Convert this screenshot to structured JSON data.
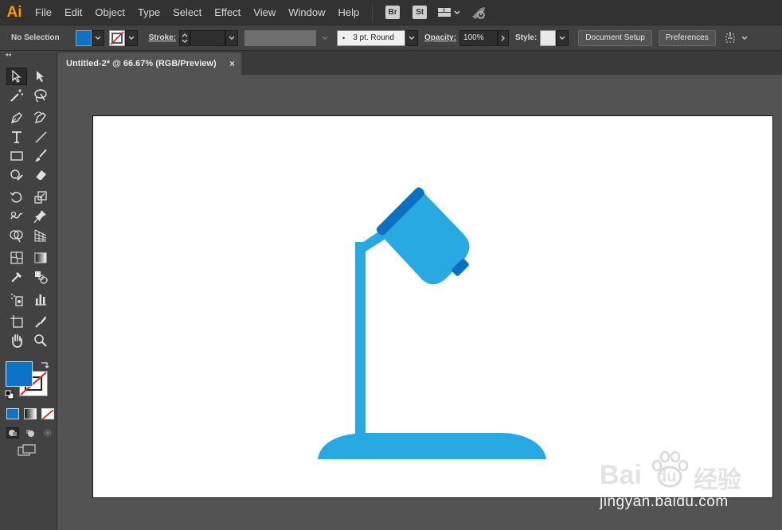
{
  "app": {
    "logo": "Ai"
  },
  "menu": [
    "File",
    "Edit",
    "Object",
    "Type",
    "Select",
    "Effect",
    "View",
    "Window",
    "Help"
  ],
  "menu_badges": {
    "bridge": "Br",
    "stock": "St"
  },
  "control": {
    "selection": "No Selection",
    "fill_color": "#0a74c9",
    "stroke_label": "Stroke:",
    "brush": "3 pt. Round",
    "opacity_label": "Opacity:",
    "opacity_value": "100%",
    "style_label": "Style:",
    "document_setup": "Document Setup",
    "preferences": "Preferences"
  },
  "document": {
    "tab_title": "Untitled-2* @ 66.67% (RGB/Preview)",
    "close": "×"
  },
  "toolbar": {
    "collapse": "◂◂",
    "fill_color": "#0a74c9"
  },
  "artwork": {
    "lamp_light_color": "#29a9e1",
    "lamp_dark_color": "#0c71c3"
  },
  "watermark": {
    "brand": "Bai",
    "brand2": "du",
    "cn": "经验",
    "url": "jingyan.baidu.com"
  }
}
